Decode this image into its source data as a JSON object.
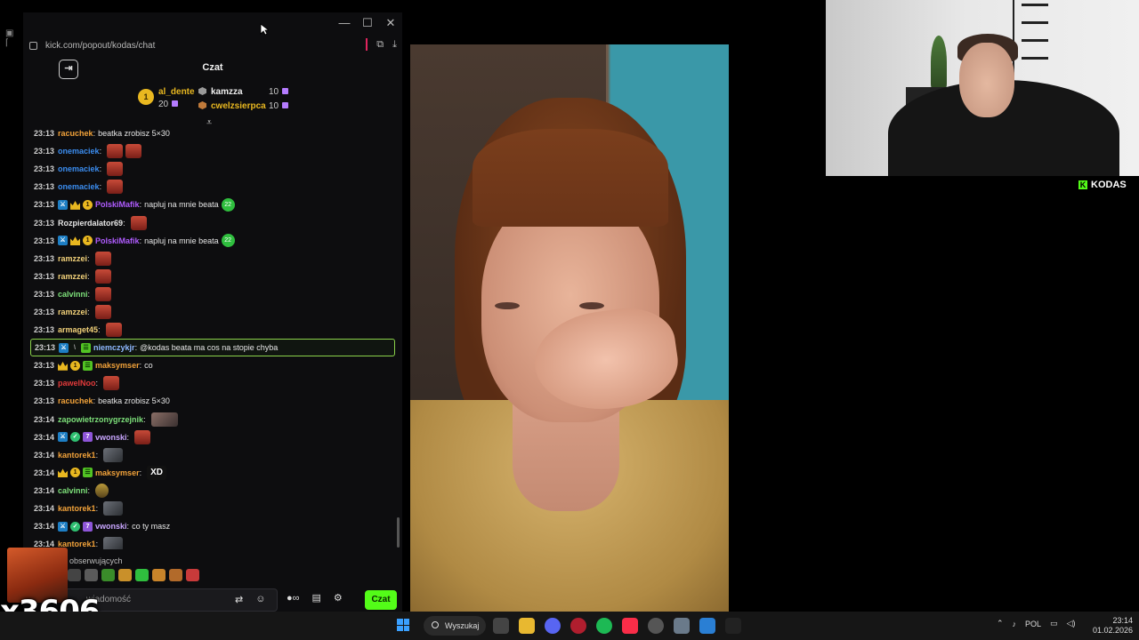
{
  "browser": {
    "url": "kick.com/popout/kodas/chat",
    "window_controls": [
      "—",
      "☐",
      "✕"
    ]
  },
  "chat": {
    "title": "Czat",
    "leaderboard": {
      "first": {
        "rank": "1",
        "name": "al_dente",
        "points": "20"
      },
      "others": [
        {
          "name": "kamzza",
          "points": "10"
        },
        {
          "name": "cwelzsierpca",
          "points": "10"
        }
      ]
    },
    "messages": [
      {
        "time": "23:13",
        "user": "racuchek",
        "color": "#f3a33a",
        "badges": [],
        "text": "beatka zrobisz 5×30",
        "emotes": []
      },
      {
        "time": "23:13",
        "user": "onemaciek",
        "color": "#3b8df0",
        "badges": [],
        "text": "",
        "emotes": [
          "face",
          "face"
        ]
      },
      {
        "time": "23:13",
        "user": "onemaciek",
        "color": "#3b8df0",
        "badges": [],
        "text": "",
        "emotes": [
          "face"
        ]
      },
      {
        "time": "23:13",
        "user": "onemaciek",
        "color": "#3b8df0",
        "badges": [],
        "text": "",
        "emotes": [
          "face"
        ]
      },
      {
        "time": "23:13",
        "user": "PolskiMafik",
        "color": "#b05cff",
        "badges": [
          "mod",
          "crown",
          "sub"
        ],
        "text": "napluj na mnie beata",
        "emotes": [
          "green"
        ]
      },
      {
        "time": "23:13",
        "user": "Rozpierdalator69",
        "color": "#e6e6e6",
        "badges": [],
        "text": "",
        "emotes": [
          "face"
        ]
      },
      {
        "time": "23:13",
        "user": "PolskiMafik",
        "color": "#b05cff",
        "badges": [
          "mod",
          "crown",
          "sub"
        ],
        "text": "napluj na mnie beata",
        "emotes": [
          "green"
        ]
      },
      {
        "time": "23:13",
        "user": "ramzzei",
        "color": "#f3d27a",
        "badges": [],
        "text": "",
        "emotes": [
          "face"
        ]
      },
      {
        "time": "23:13",
        "user": "ramzzei",
        "color": "#f3d27a",
        "badges": [],
        "text": "",
        "emotes": [
          "face"
        ]
      },
      {
        "time": "23:13",
        "user": "calvinni",
        "color": "#7de07a",
        "badges": [],
        "text": "",
        "emotes": [
          "face"
        ]
      },
      {
        "time": "23:13",
        "user": "ramzzei",
        "color": "#f3d27a",
        "badges": [],
        "text": "",
        "emotes": [
          "face"
        ]
      },
      {
        "time": "23:13",
        "user": "armaget45",
        "color": "#f3d27a",
        "badges": [],
        "text": "",
        "emotes": [
          "face"
        ]
      },
      {
        "time": "23:13",
        "user": "niemczykjr",
        "color": "#8fb8ff",
        "badges": [
          "mod",
          "slash",
          "green"
        ],
        "text": "@kodas beata ma cos na stopie chyba",
        "emotes": [],
        "highlight": true
      },
      {
        "time": "23:13",
        "user": "maksymser",
        "color": "#f3a33a",
        "badges": [
          "crown",
          "sub",
          "green"
        ],
        "text": "co",
        "emotes": []
      },
      {
        "time": "23:13",
        "user": "pawelNoo",
        "color": "#e23a3a",
        "badges": [],
        "text": "",
        "emotes": [
          "face"
        ]
      },
      {
        "time": "23:13",
        "user": "racuchek",
        "color": "#f3a33a",
        "badges": [],
        "text": "beatka zrobisz 5×30",
        "emotes": []
      },
      {
        "time": "23:14",
        "user": "zapowietrzonygrzejnik",
        "color": "#7de07a",
        "badges": [],
        "text": "",
        "emotes": [
          "pic2"
        ]
      },
      {
        "time": "23:14",
        "user": "vwonski",
        "color": "#c9a6ff",
        "badges": [
          "mod",
          "verified",
          "gifter"
        ],
        "text": "",
        "emotes": [
          "face"
        ]
      },
      {
        "time": "23:14",
        "user": "kantorek1",
        "color": "#f3a33a",
        "badges": [],
        "text": "",
        "emotes": [
          "pic"
        ]
      },
      {
        "time": "23:14",
        "user": "maksymser",
        "color": "#f3a33a",
        "badges": [
          "crown",
          "sub",
          "green"
        ],
        "text": "",
        "emotes": [
          "xd"
        ]
      },
      {
        "time": "23:14",
        "user": "calvinni",
        "color": "#7de07a",
        "badges": [],
        "text": "",
        "emotes": [
          "tiny"
        ]
      },
      {
        "time": "23:14",
        "user": "kantorek1",
        "color": "#f3a33a",
        "badges": [],
        "text": "",
        "emotes": [
          "pic"
        ]
      },
      {
        "time": "23:14",
        "user": "vwonski",
        "color": "#c9a6ff",
        "badges": [
          "mod",
          "verified",
          "gifter"
        ],
        "text": "co ty masz",
        "emotes": []
      },
      {
        "time": "23:14",
        "user": "kantorek1",
        "color": "#f3a33a",
        "badges": [],
        "text": "",
        "emotes": [
          "pic"
        ]
      }
    ],
    "followers_label": "obserwujących",
    "input_placeholder": "wiadomość",
    "send_label": "Czat"
  },
  "overlay": {
    "counter": "x3606",
    "emote_xd": "XD"
  },
  "stream": {
    "channel_tag": "KODAS"
  },
  "taskbar": {
    "search_label": "Wyszukaj",
    "language": "POL",
    "time": "23:14",
    "date": "01.02.2026"
  }
}
